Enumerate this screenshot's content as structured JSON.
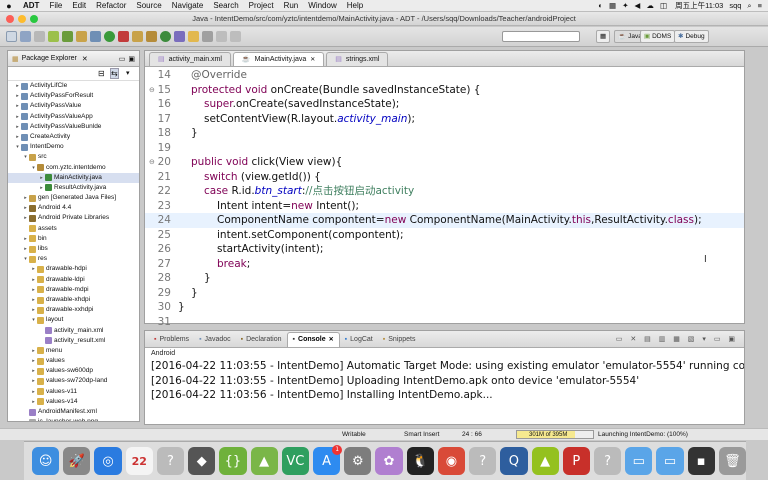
{
  "menubar": {
    "app": "ADT",
    "items": [
      "File",
      "Edit",
      "Refactor",
      "Source",
      "Navigate",
      "Search",
      "Project",
      "Run",
      "Window",
      "Help"
    ],
    "clock": "周五上午11:03",
    "user": "sqq"
  },
  "window": {
    "title": "Java - IntentDemo/src/com/yztc/intentdemo/MainActivity.java - ADT - /Users/sqq/Downloads/Teacher/androidProject"
  },
  "perspectives": {
    "java": "Java",
    "ddms": "DDMS",
    "debug": "Debug"
  },
  "explorer": {
    "title": "Package Explorer",
    "rows": [
      {
        "label": "ActivityLifCle",
        "indent": 1,
        "tw": "▸",
        "icon": "project"
      },
      {
        "label": "ActivityPassForResult",
        "indent": 1,
        "tw": "▸",
        "icon": "project"
      },
      {
        "label": "ActivityPassValue",
        "indent": 1,
        "tw": "▸",
        "icon": "project"
      },
      {
        "label": "ActivityPassValueApp",
        "indent": 1,
        "tw": "▸",
        "icon": "project"
      },
      {
        "label": "ActivityPassValueBunlde",
        "indent": 1,
        "tw": "▸",
        "icon": "project"
      },
      {
        "label": "CreateActivity",
        "indent": 1,
        "tw": "▸",
        "icon": "project"
      },
      {
        "label": "IntentDemo",
        "indent": 1,
        "tw": "▾",
        "icon": "project"
      },
      {
        "label": "src",
        "indent": 2,
        "tw": "▾",
        "icon": "src"
      },
      {
        "label": "com.yztc.intentdemo",
        "indent": 3,
        "tw": "▾",
        "icon": "package"
      },
      {
        "label": "MainActivity.java",
        "indent": 4,
        "tw": "▸",
        "icon": "java",
        "selected": true
      },
      {
        "label": "ResultActivity.java",
        "indent": 4,
        "tw": "▸",
        "icon": "java"
      },
      {
        "label": "gen [Generated Java Files]",
        "indent": 2,
        "tw": "▸",
        "icon": "src"
      },
      {
        "label": "Android 4.4",
        "indent": 2,
        "tw": "▸",
        "icon": "lib"
      },
      {
        "label": "Android Private Libraries",
        "indent": 2,
        "tw": "▸",
        "icon": "lib"
      },
      {
        "label": "assets",
        "indent": 2,
        "tw": "",
        "icon": "folder"
      },
      {
        "label": "bin",
        "indent": 2,
        "tw": "▸",
        "icon": "folder"
      },
      {
        "label": "libs",
        "indent": 2,
        "tw": "▸",
        "icon": "folder"
      },
      {
        "label": "res",
        "indent": 2,
        "tw": "▾",
        "icon": "folder"
      },
      {
        "label": "drawable-hdpi",
        "indent": 3,
        "tw": "▸",
        "icon": "folder"
      },
      {
        "label": "drawable-ldpi",
        "indent": 3,
        "tw": "▸",
        "icon": "folder"
      },
      {
        "label": "drawable-mdpi",
        "indent": 3,
        "tw": "▸",
        "icon": "folder"
      },
      {
        "label": "drawable-xhdpi",
        "indent": 3,
        "tw": "▸",
        "icon": "folder"
      },
      {
        "label": "drawable-xxhdpi",
        "indent": 3,
        "tw": "▸",
        "icon": "folder"
      },
      {
        "label": "layout",
        "indent": 3,
        "tw": "▾",
        "icon": "folder"
      },
      {
        "label": "activity_main.xml",
        "indent": 4,
        "tw": "",
        "icon": "xml"
      },
      {
        "label": "activity_result.xml",
        "indent": 4,
        "tw": "",
        "icon": "xml"
      },
      {
        "label": "menu",
        "indent": 3,
        "tw": "▸",
        "icon": "folder"
      },
      {
        "label": "values",
        "indent": 3,
        "tw": "▸",
        "icon": "folder"
      },
      {
        "label": "values-sw600dp",
        "indent": 3,
        "tw": "▸",
        "icon": "folder"
      },
      {
        "label": "values-sw720dp-land",
        "indent": 3,
        "tw": "▸",
        "icon": "folder"
      },
      {
        "label": "values-v11",
        "indent": 3,
        "tw": "▸",
        "icon": "folder"
      },
      {
        "label": "values-v14",
        "indent": 3,
        "tw": "▸",
        "icon": "folder"
      },
      {
        "label": "AndroidManifest.xml",
        "indent": 2,
        "tw": "",
        "icon": "xml"
      },
      {
        "label": "ic_launcher-web.png",
        "indent": 2,
        "tw": "",
        "icon": "file"
      }
    ]
  },
  "editor": {
    "tabs": [
      {
        "label": "activity_main.xml",
        "active": false
      },
      {
        "label": "MainActivity.java",
        "active": true
      },
      {
        "label": "strings.xml",
        "active": false
      }
    ],
    "lines": [
      {
        "n": "14",
        "indent": 0,
        "fold": "",
        "hl": false,
        "tokens": [
          [
            "ann",
            "@Override"
          ]
        ]
      },
      {
        "n": "15",
        "indent": 0,
        "fold": "⊖",
        "hl": false,
        "tokens": [
          [
            "kw",
            "protected void "
          ],
          [
            "",
            "onCreate(Bundle savedInstanceState) {"
          ]
        ]
      },
      {
        "n": "16",
        "indent": 1,
        "fold": "",
        "hl": false,
        "tokens": [
          [
            "kw",
            "super"
          ],
          [
            "",
            ".onCreate(savedInstanceState);"
          ]
        ]
      },
      {
        "n": "17",
        "indent": 1,
        "fold": "",
        "hl": false,
        "tokens": [
          [
            "",
            "setContentView(R.layout."
          ],
          [
            "fld",
            "activity_main"
          ],
          [
            "",
            ");"
          ]
        ]
      },
      {
        "n": "18",
        "indent": 0,
        "fold": "",
        "hl": false,
        "tokens": [
          [
            "",
            "}"
          ]
        ]
      },
      {
        "n": "19",
        "indent": 0,
        "fold": "",
        "hl": false,
        "tokens": []
      },
      {
        "n": "20",
        "indent": 0,
        "fold": "⊖",
        "hl": false,
        "tokens": [
          [
            "kw",
            "public void "
          ],
          [
            "",
            "click(View view){"
          ]
        ]
      },
      {
        "n": "21",
        "indent": 1,
        "fold": "",
        "hl": false,
        "tokens": [
          [
            "kw",
            "switch "
          ],
          [
            "",
            "(view.getId()) {"
          ]
        ]
      },
      {
        "n": "22",
        "indent": 1,
        "fold": "",
        "hl": false,
        "tokens": [
          [
            "kw",
            "case "
          ],
          [
            "",
            "R.id."
          ],
          [
            "fld",
            "btn_start"
          ],
          [
            "",
            ":"
          ],
          [
            "cmt",
            "//点击按钮启动activity"
          ]
        ]
      },
      {
        "n": "23",
        "indent": 2,
        "fold": "",
        "hl": false,
        "tokens": [
          [
            "",
            "Intent intent="
          ],
          [
            "kw",
            "new "
          ],
          [
            "",
            "Intent();"
          ]
        ]
      },
      {
        "n": "24",
        "indent": 2,
        "fold": "",
        "hl": true,
        "tokens": [
          [
            "",
            "ComponentName compontent="
          ],
          [
            "kw",
            "new "
          ],
          [
            "",
            "ComponentName(MainActivity."
          ],
          [
            "kw",
            "this"
          ],
          [
            "",
            ",ResultActivity."
          ],
          [
            "kw",
            "class"
          ],
          [
            "",
            ");"
          ]
        ]
      },
      {
        "n": "25",
        "indent": 2,
        "fold": "",
        "hl": false,
        "tokens": [
          [
            "",
            "intent.setComponent(compontent);"
          ]
        ]
      },
      {
        "n": "26",
        "indent": 2,
        "fold": "",
        "hl": false,
        "tokens": [
          [
            "",
            "startActivity(intent);"
          ]
        ]
      },
      {
        "n": "27",
        "indent": 2,
        "fold": "",
        "hl": false,
        "tokens": [
          [
            "kw",
            "break"
          ],
          [
            "",
            ";"
          ]
        ]
      },
      {
        "n": "28",
        "indent": 1,
        "fold": "",
        "hl": false,
        "tokens": [
          [
            "",
            "}"
          ]
        ]
      },
      {
        "n": "29",
        "indent": 0,
        "fold": "",
        "hl": false,
        "tokens": [
          [
            "",
            "}"
          ]
        ]
      },
      {
        "n": "30",
        "indent": -1,
        "fold": "",
        "hl": false,
        "tokens": [
          [
            "",
            "}"
          ]
        ]
      },
      {
        "n": "31",
        "indent": 0,
        "fold": "",
        "hl": false,
        "tokens": []
      }
    ]
  },
  "console": {
    "tabs": [
      {
        "label": "Problems",
        "active": false
      },
      {
        "label": "Javadoc",
        "active": false
      },
      {
        "label": "Declaration",
        "active": false
      },
      {
        "label": "Console",
        "active": true
      },
      {
        "label": "LogCat",
        "active": false
      },
      {
        "label": "Snippets",
        "active": false
      }
    ],
    "label": "Android",
    "lines": [
      "[2016-04-22 11:03:55 - IntentDemo] Automatic Target Mode: using existing emulator 'emulator-5554' running com",
      "[2016-04-22 11:03:55 - IntentDemo] Uploading IntentDemo.apk onto device 'emulator-5554'",
      "[2016-04-22 11:03:56 - IntentDemo] Installing IntentDemo.apk..."
    ]
  },
  "statusbar": {
    "mode": "Writable",
    "insert": "Smart Insert",
    "position": "24 : 66",
    "heap": "301M of 395M",
    "heap_fraction": 0.76,
    "launch": "Launching IntentDemo: (100%)"
  },
  "dock": {
    "icons": [
      {
        "name": "finder-icon",
        "glyph": "☺",
        "color": "#3d8ee0"
      },
      {
        "name": "launchpad-icon",
        "glyph": "🚀",
        "color": "#888"
      },
      {
        "name": "safari-icon",
        "glyph": "◎",
        "color": "#2a7be0"
      },
      {
        "name": "calendar-icon",
        "glyph": "22",
        "color": "#f4f4f4",
        "dark": true
      },
      {
        "name": "help-icon",
        "glyph": "?",
        "color": "#bbb"
      },
      {
        "name": "aptana-icon",
        "glyph": "◆",
        "color": "#555"
      },
      {
        "name": "braces-icon",
        "glyph": "{}",
        "color": "#6fb13b"
      },
      {
        "name": "android-studio-icon",
        "glyph": "▲",
        "color": "#7ab648"
      },
      {
        "name": "vc-icon",
        "glyph": "VC",
        "color": "#2f9f5f"
      },
      {
        "name": "appstore-icon",
        "glyph": "A",
        "color": "#2e8bf0",
        "badge": "1"
      },
      {
        "name": "settings-icon",
        "glyph": "⚙",
        "color": "#7d7d7d"
      },
      {
        "name": "photos-icon",
        "glyph": "✿",
        "color": "#b07fd0"
      },
      {
        "name": "qq-icon",
        "glyph": "🐧",
        "color": "#222"
      },
      {
        "name": "chrome-icon",
        "glyph": "◉",
        "color": "#d94a38"
      },
      {
        "name": "help-icon-2",
        "glyph": "?",
        "color": "#bbb"
      },
      {
        "name": "quicktime-icon",
        "glyph": "Q",
        "color": "#2e5e9e"
      },
      {
        "name": "android-icon",
        "glyph": "▲",
        "color": "#94c11f"
      },
      {
        "name": "wps-icon",
        "glyph": "P",
        "color": "#c8302a"
      },
      {
        "name": "help-icon-3",
        "glyph": "?",
        "color": "#bbb"
      },
      {
        "name": "folder-icon",
        "glyph": "▭",
        "color": "#5aa5e8"
      },
      {
        "name": "downloads-icon",
        "glyph": "▭",
        "color": "#5aa5e8"
      },
      {
        "name": "screen-icon",
        "glyph": "▪",
        "color": "#333"
      },
      {
        "name": "trash-icon",
        "glyph": "🗑",
        "color": "#9a9a9a"
      }
    ]
  },
  "colors": {
    "keyword": "#7f0055",
    "field": "#0000c0",
    "comment": "#3f7f5f",
    "annotation": "#646464",
    "current_line": "#e8f2fe"
  }
}
